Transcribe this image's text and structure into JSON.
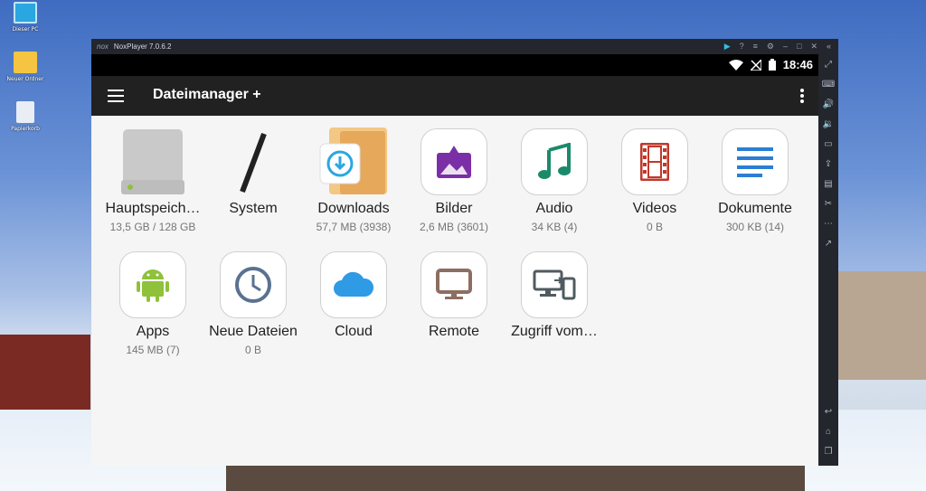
{
  "desktop": {
    "icons": [
      {
        "label": "Dieser PC",
        "icon": "monitor-icon"
      },
      {
        "label": "Neuer Ordner",
        "icon": "folder-icon"
      },
      {
        "label": "Papierkorb",
        "icon": "recycle-bin-icon"
      }
    ]
  },
  "window": {
    "logo": "nox",
    "title": "NoxPlayer 7.0.6.2",
    "titlebar_icons": [
      "play-icon",
      "help-icon",
      "menu-icon",
      "settings-icon",
      "minimize-icon",
      "maximize-icon",
      "close-icon",
      "collapse-icon"
    ]
  },
  "statusbar": {
    "time": "18:46",
    "icons": [
      "wifi-icon",
      "no-signal-icon",
      "battery-icon"
    ]
  },
  "appbar": {
    "title": "Dateimanager +",
    "menu_icon": "hamburger-icon",
    "overflow_icon": "more-vert-icon"
  },
  "tiles": [
    {
      "label": "Hauptspeich…",
      "sub": "13,5 GB / 128 GB",
      "icon": "hard-drive-icon"
    },
    {
      "label": "System",
      "sub": "",
      "icon": "slash-icon"
    },
    {
      "label": "Downloads",
      "sub": "57,7 MB (3938)",
      "icon": "downloads-folder-icon"
    },
    {
      "label": "Bilder",
      "sub": "2,6 MB (3601)",
      "icon": "image-icon"
    },
    {
      "label": "Audio",
      "sub": "34 KB (4)",
      "icon": "music-note-icon"
    },
    {
      "label": "Videos",
      "sub": "0 B",
      "icon": "film-icon"
    },
    {
      "label": "Dokumente",
      "sub": "300 KB (14)",
      "icon": "document-lines-icon"
    },
    {
      "label": "Apps",
      "sub": "145 MB (7)",
      "icon": "android-icon"
    },
    {
      "label": "Neue Dateien",
      "sub": "0 B",
      "icon": "clock-icon"
    },
    {
      "label": "Cloud",
      "sub": "",
      "icon": "cloud-icon"
    },
    {
      "label": "Remote",
      "sub": "",
      "icon": "monitor-icon"
    },
    {
      "label": "Zugriff vom…",
      "sub": "",
      "icon": "devices-icon"
    }
  ],
  "sidebar_icons": [
    "expand-icon",
    "keyboard-icon",
    "volume-up-icon",
    "volume-down-icon",
    "screen-icon",
    "install-apk-icon",
    "toolbox-icon",
    "scissors-icon",
    "more-icon",
    "external-icon",
    "back-icon",
    "home-icon",
    "recents-icon"
  ],
  "colors": {
    "accent_music": "#1b8a6b",
    "accent_image": "#7b2fa6",
    "accent_video": "#c0392b",
    "accent_docs": "#2a7fd4",
    "accent_android": "#8fc13a",
    "accent_cloud": "#2e9be4"
  }
}
